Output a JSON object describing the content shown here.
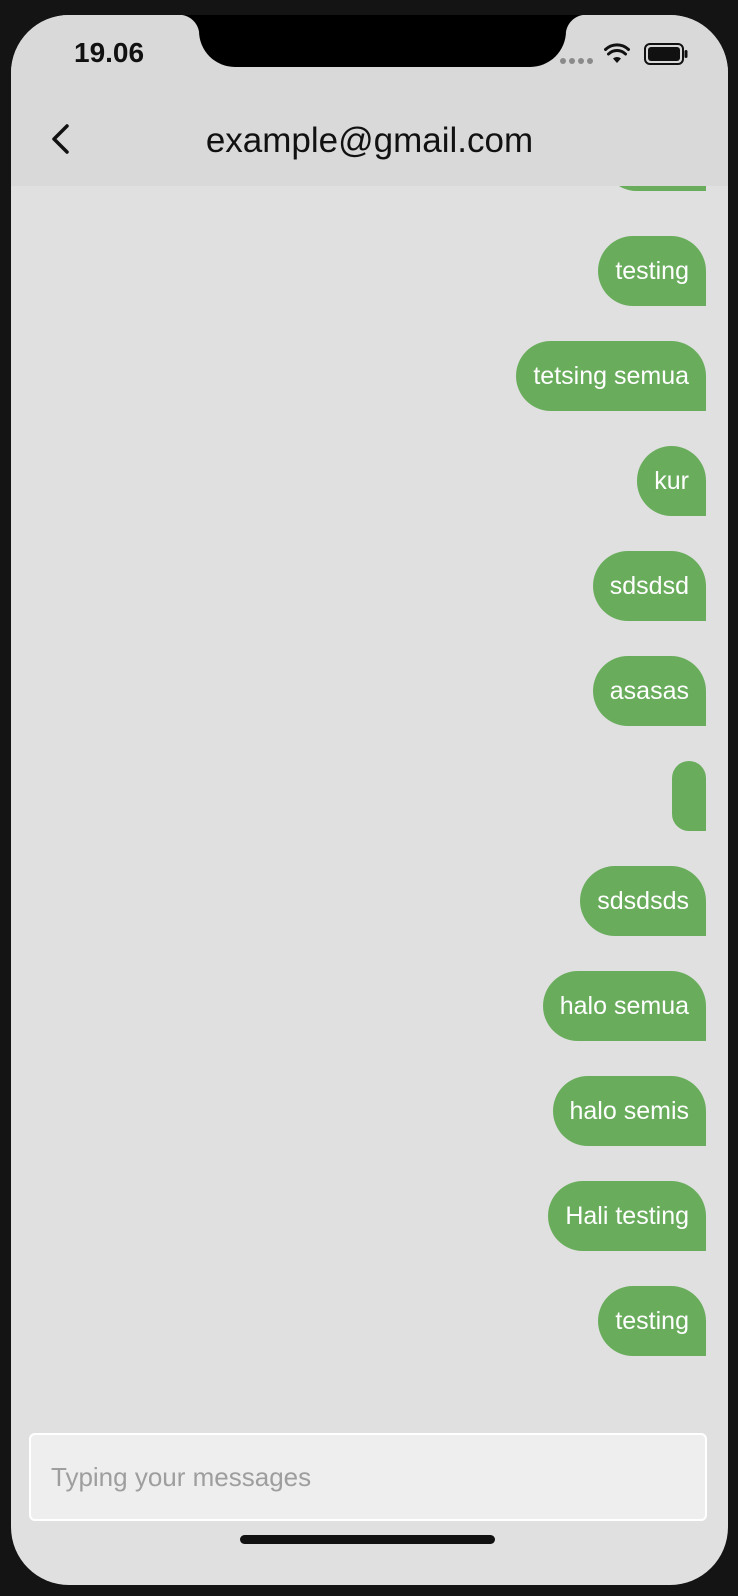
{
  "status_bar": {
    "time": "19.06",
    "icons": [
      "signal-icon",
      "wifi-icon",
      "battery-icon"
    ]
  },
  "app_bar": {
    "back_icon": "chevron-left-icon",
    "title": "example@gmail.com"
  },
  "messages": [
    {
      "text": "",
      "sender": "me"
    },
    {
      "text": "testing",
      "sender": "me"
    },
    {
      "text": "tetsing semua",
      "sender": "me"
    },
    {
      "text": "kur",
      "sender": "me"
    },
    {
      "text": "sdsdsd",
      "sender": "me"
    },
    {
      "text": "asasas",
      "sender": "me"
    },
    {
      "text": "",
      "sender": "me"
    },
    {
      "text": "sdsdsds",
      "sender": "me"
    },
    {
      "text": "halo semua",
      "sender": "me"
    },
    {
      "text": "halo semis",
      "sender": "me"
    },
    {
      "text": "Hali testing",
      "sender": "me"
    },
    {
      "text": "testing",
      "sender": "me"
    }
  ],
  "composer": {
    "placeholder": "Typing your messages",
    "value": ""
  },
  "colors": {
    "bubble": "#69ad5c",
    "background": "#e0e0e0",
    "app_bar": "#d9d9d9"
  }
}
